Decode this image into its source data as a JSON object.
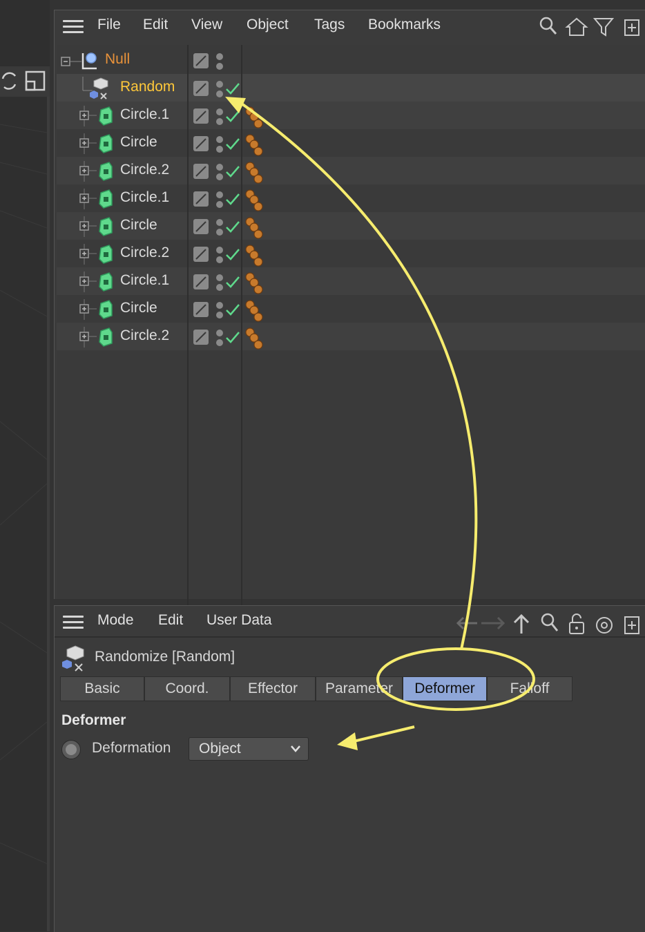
{
  "object_manager": {
    "menu": [
      "File",
      "Edit",
      "View",
      "Object",
      "Tags",
      "Bookmarks"
    ],
    "toolbar_icons": [
      "search-icon",
      "home-icon",
      "filter-icon",
      "new-window-icon"
    ],
    "objects": [
      {
        "name": "Null",
        "type": "null-icon",
        "color": "#e8923a"
      },
      {
        "name": "Random",
        "type": "random-effector-icon",
        "color": "#ffc83a"
      },
      {
        "name": "Circle.1",
        "type": "cloner-icon"
      },
      {
        "name": "Circle",
        "type": "cloner-icon"
      },
      {
        "name": "Circle.2",
        "type": "cloner-icon"
      },
      {
        "name": "Circle.1",
        "type": "cloner-icon"
      },
      {
        "name": "Circle",
        "type": "cloner-icon"
      },
      {
        "name": "Circle.2",
        "type": "cloner-icon"
      },
      {
        "name": "Circle.1",
        "type": "cloner-icon"
      },
      {
        "name": "Circle",
        "type": "cloner-icon"
      },
      {
        "name": "Circle.2",
        "type": "cloner-icon"
      }
    ]
  },
  "attribute_manager": {
    "menu": [
      "Mode",
      "Edit",
      "User Data"
    ],
    "toolbar_icons": [
      "back-arrow-icon",
      "forward-arrow-icon",
      "up-arrow-icon",
      "search-icon",
      "lock-icon",
      "target-icon",
      "new-window-icon"
    ],
    "title": "Randomize [Random]",
    "tabs": [
      "Basic",
      "Coord.",
      "Effector",
      "Parameter",
      "Deformer",
      "Falloff"
    ],
    "active_tab": "Deformer",
    "section": "Deformer",
    "deformation_label": "Deformation",
    "deformation_value": "Object"
  },
  "colors": {
    "active_tab": "#8ea6d8",
    "annotation": "#f6ec6e",
    "null_label": "#e8923a",
    "random_label": "#ffc83a",
    "cloner_green": "#5fd98c"
  }
}
